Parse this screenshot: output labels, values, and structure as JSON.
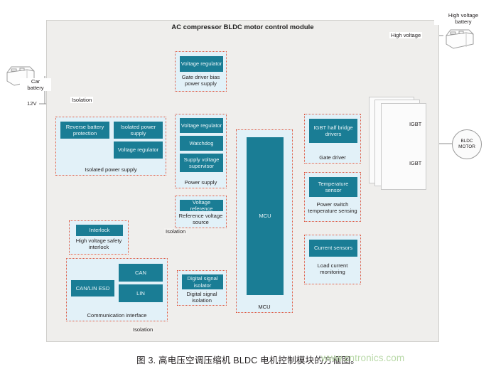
{
  "figure": {
    "module_title": "AC compressor BLDC motor control module",
    "caption": "图 3. 高电压空调压缩机 BLDC 电机控制模块的方框图。",
    "watermark": "www.cntronics.com"
  },
  "external": {
    "car_battery_label": "Car\nbattery",
    "car_battery_line1": "Car",
    "car_battery_line2": "battery",
    "car_battery_icon": "battery-icon",
    "supply_voltage": "12V",
    "hv_battery_line1": "High voltage",
    "hv_battery_line2": "battery",
    "hv_battery_icon": "battery-icon",
    "hv_rail_label": "High voltage",
    "motor_line1": "BLDC",
    "motor_line2": "MOTOR"
  },
  "isolation_labels": {
    "top_left": "Isolation",
    "middle": "Isolation",
    "bottom": "Isolation"
  },
  "groups": {
    "gate_driver_bias": {
      "caption_line1": "Gate driver bias",
      "caption_line2": "power supply",
      "blocks": [
        {
          "label": "Voltage regulator"
        }
      ]
    },
    "isolated_power_supply": {
      "caption": "Isolated power supply",
      "blocks": [
        {
          "label": "Reverse battery protection"
        },
        {
          "label": "Isolated power supply"
        },
        {
          "label": "Voltage regulator"
        }
      ]
    },
    "power_supply": {
      "caption": "Power supply",
      "blocks": [
        {
          "label": "Voltage regulator"
        },
        {
          "label": "Watchdog"
        },
        {
          "label": "Supply voltage supervisor"
        }
      ]
    },
    "reference_voltage": {
      "caption_line1": "Reference voltage",
      "caption_line2": "source",
      "blocks": [
        {
          "label": "Voltage reference"
        }
      ]
    },
    "hv_safety_interlock": {
      "caption_line1": "High voltage safety",
      "caption_line2": "interlock",
      "blocks": [
        {
          "label": "Interlock"
        }
      ]
    },
    "communication_interface": {
      "caption": "Communication interface",
      "blocks": [
        {
          "label": "CAN/LIN ESD"
        },
        {
          "label": "CAN"
        },
        {
          "label": "LIN"
        }
      ]
    },
    "digital_signal_isolation": {
      "caption_line1": "Digital signal",
      "caption_line2": "isolation",
      "blocks": [
        {
          "label": "Digital signal isolator"
        }
      ]
    },
    "mcu": {
      "caption": "MCU",
      "blocks": [
        {
          "label": "MCU"
        }
      ]
    },
    "gate_driver": {
      "caption": "Gate driver",
      "blocks": [
        {
          "label": "IGBT half bridge drivers"
        }
      ]
    },
    "power_switch_temp": {
      "caption_line1": "Power switch",
      "caption_line2": "temperature sensing",
      "blocks": [
        {
          "label": "Temperature sensor"
        }
      ]
    },
    "load_current": {
      "caption_line1": "Load current",
      "caption_line2": "monitoring",
      "blocks": [
        {
          "label": "Current sensors"
        }
      ]
    }
  },
  "inverter": {
    "igbt_high": "IGBT",
    "igbt_low": "IGBT",
    "ground_icon": "ground-icon"
  },
  "colors": {
    "block_teal": "#1a7d95",
    "group_fill": "#e2f1f8",
    "group_border": "#e2583e",
    "module_fill": "#efeeec",
    "line": "#8d8d8d",
    "watermark": "#b9d9a8"
  }
}
